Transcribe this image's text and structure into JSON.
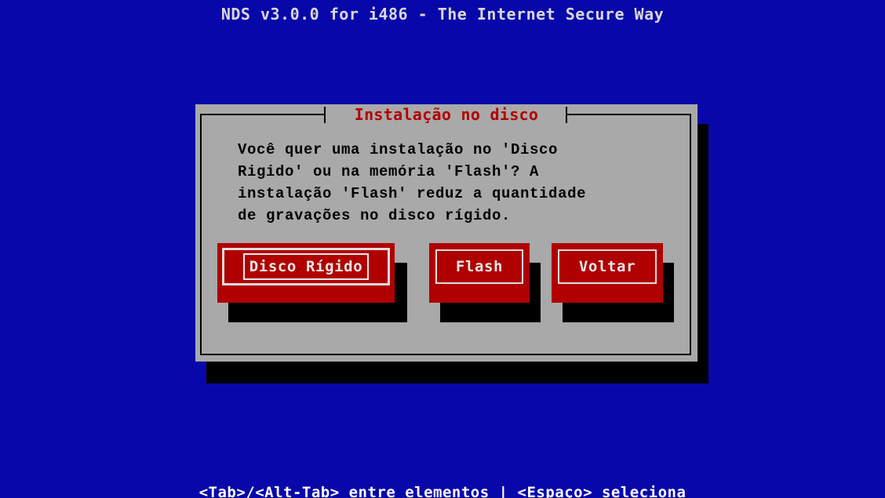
{
  "header": {
    "title": "NDS v3.0.0 for i486 - The Internet Secure Way"
  },
  "dialog": {
    "title": "Instalação no disco",
    "message": "Você quer uma instalação no 'Disco\nRigido' ou na memória 'Flash'? A\ninstalação 'Flash' reduz a quantidade\nde gravações no disco rígido.",
    "buttons": [
      {
        "label": "Disco Rígido",
        "focused": true
      },
      {
        "label": "Flash",
        "focused": false
      },
      {
        "label": "Voltar",
        "focused": false
      }
    ]
  },
  "status_bar": {
    "text": "<Tab>/<Alt-Tab> entre elementos  |  <Espaço> seleciona"
  },
  "colors": {
    "background": "#0808aa",
    "dialog": "#a9a9a9",
    "button": "#b00000",
    "title_text": "#b20000"
  }
}
